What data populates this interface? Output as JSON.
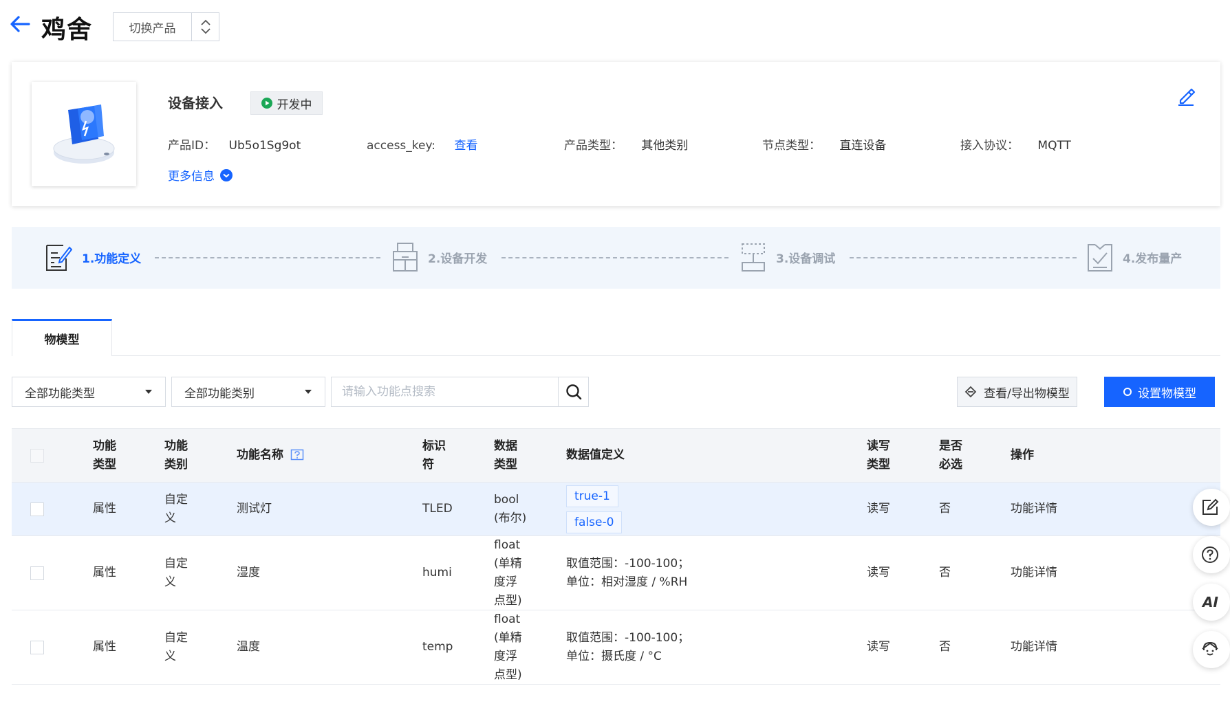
{
  "header": {
    "title": "鸡舍",
    "switch_label": "切换产品"
  },
  "product": {
    "section_title": "设备接入",
    "status": "开发中",
    "fields": [
      {
        "key": "产品ID：",
        "value": "Ub5o1Sg9ot"
      },
      {
        "key": "access_key:",
        "value": "查看"
      },
      {
        "key": "产品类型：",
        "value": "其他类别"
      },
      {
        "key": "节点类型：",
        "value": "直连设备"
      },
      {
        "key": "接入协议：",
        "value": "MQTT"
      }
    ],
    "more_info": "更多信息"
  },
  "steps": [
    {
      "label": "1.功能定义",
      "active": true
    },
    {
      "label": "2.设备开发",
      "active": false
    },
    {
      "label": "3.设备调试",
      "active": false
    },
    {
      "label": "4.发布量产",
      "active": false
    }
  ],
  "tabs": [
    {
      "label": "物模型"
    }
  ],
  "filters": {
    "type_select": "全部功能类型",
    "category_select": "全部功能类别",
    "search_placeholder": "请输入功能点搜索",
    "view_export": "查看/导出物模型",
    "set_model": "设置物模型"
  },
  "table": {
    "headers": [
      "功能\n类型",
      "功能\n类别",
      "功能名称",
      "标识\n符",
      "数据\n类型",
      "数据值定义",
      "读写\n类型",
      "是否\n必选",
      "操作"
    ],
    "rows": [
      {
        "type": "属性",
        "category": "自定\n义",
        "name": "测试灯",
        "id": "TLED",
        "dtype": "bool\n(布尔)",
        "def_tags": [
          "true-1",
          "false-0"
        ],
        "def_text": "",
        "rw": "读写",
        "required": "否",
        "action": "功能详情"
      },
      {
        "type": "属性",
        "category": "自定\n义",
        "name": "湿度",
        "id": "humi",
        "dtype": "float\n(单精\n度浮\n点型)",
        "def_tags": [],
        "def_text": "取值范围：-100-100；\n单位：相对湿度 / %RH",
        "rw": "读写",
        "required": "否",
        "action": "功能详情"
      },
      {
        "type": "属性",
        "category": "自定\n义",
        "name": "温度",
        "id": "temp",
        "dtype": "float\n(单精\n度浮\n点型)",
        "def_tags": [],
        "def_text": "取值范围：-100-100；\n单位：摄氏度 / °C",
        "rw": "读写",
        "required": "否",
        "action": "功能详情"
      }
    ]
  },
  "side_buttons": {
    "ai_label": "AI"
  },
  "colors": {
    "primary": "#1664ff",
    "status_green": "#1aa756",
    "step_bg": "#f1f6fc",
    "row_highlight": "#eaf2fe"
  }
}
